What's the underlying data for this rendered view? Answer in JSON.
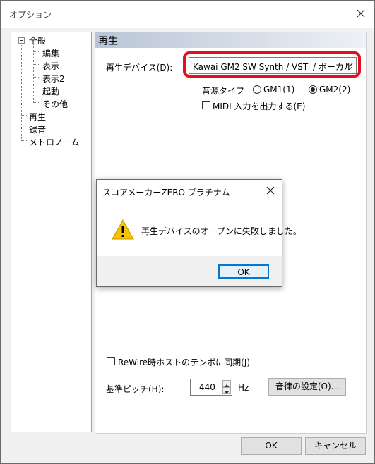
{
  "window": {
    "title": "オプション"
  },
  "tree": {
    "items": [
      {
        "label": "全般"
      },
      {
        "label": "編集"
      },
      {
        "label": "表示"
      },
      {
        "label": "表示2"
      },
      {
        "label": "起動"
      },
      {
        "label": "その他"
      },
      {
        "label": "再生"
      },
      {
        "label": "録音"
      },
      {
        "label": "メトロノーム"
      }
    ]
  },
  "panel": {
    "title": "再生",
    "device_label": "再生デバイス(D):",
    "device_value": "Kawai GM2 SW Synth / VSTi / ボーカル",
    "source_type_label": "音源タイプ",
    "radio_gm1": "GM1(1)",
    "radio_gm2": "GM2(2)",
    "midi_out_label": "MIDI 入力を出力する(E)",
    "rewire_label": "ReWire時ホストのテンポに同期(J)",
    "pitch_label": "基準ピッチ(H):",
    "pitch_value": "440",
    "pitch_unit": "Hz",
    "temperament_button": "音律の設定(O)..."
  },
  "dialog": {
    "title": "スコアメーカーZERO プラチナム",
    "message": "再生デバイスのオープンに失敗しました。",
    "ok": "OK"
  },
  "footer": {
    "ok": "OK",
    "cancel": "キャンセル"
  },
  "colors": {
    "highlight": "#e0101f",
    "header_gradient_start": "#b9c5d6",
    "dialog_ok_border": "#0078d7",
    "warning": "#f5c400"
  },
  "icons": {
    "window_close": "close-icon",
    "dialog_close": "close-icon",
    "warning": "warning-icon",
    "combo": "chevron-down-icon"
  }
}
